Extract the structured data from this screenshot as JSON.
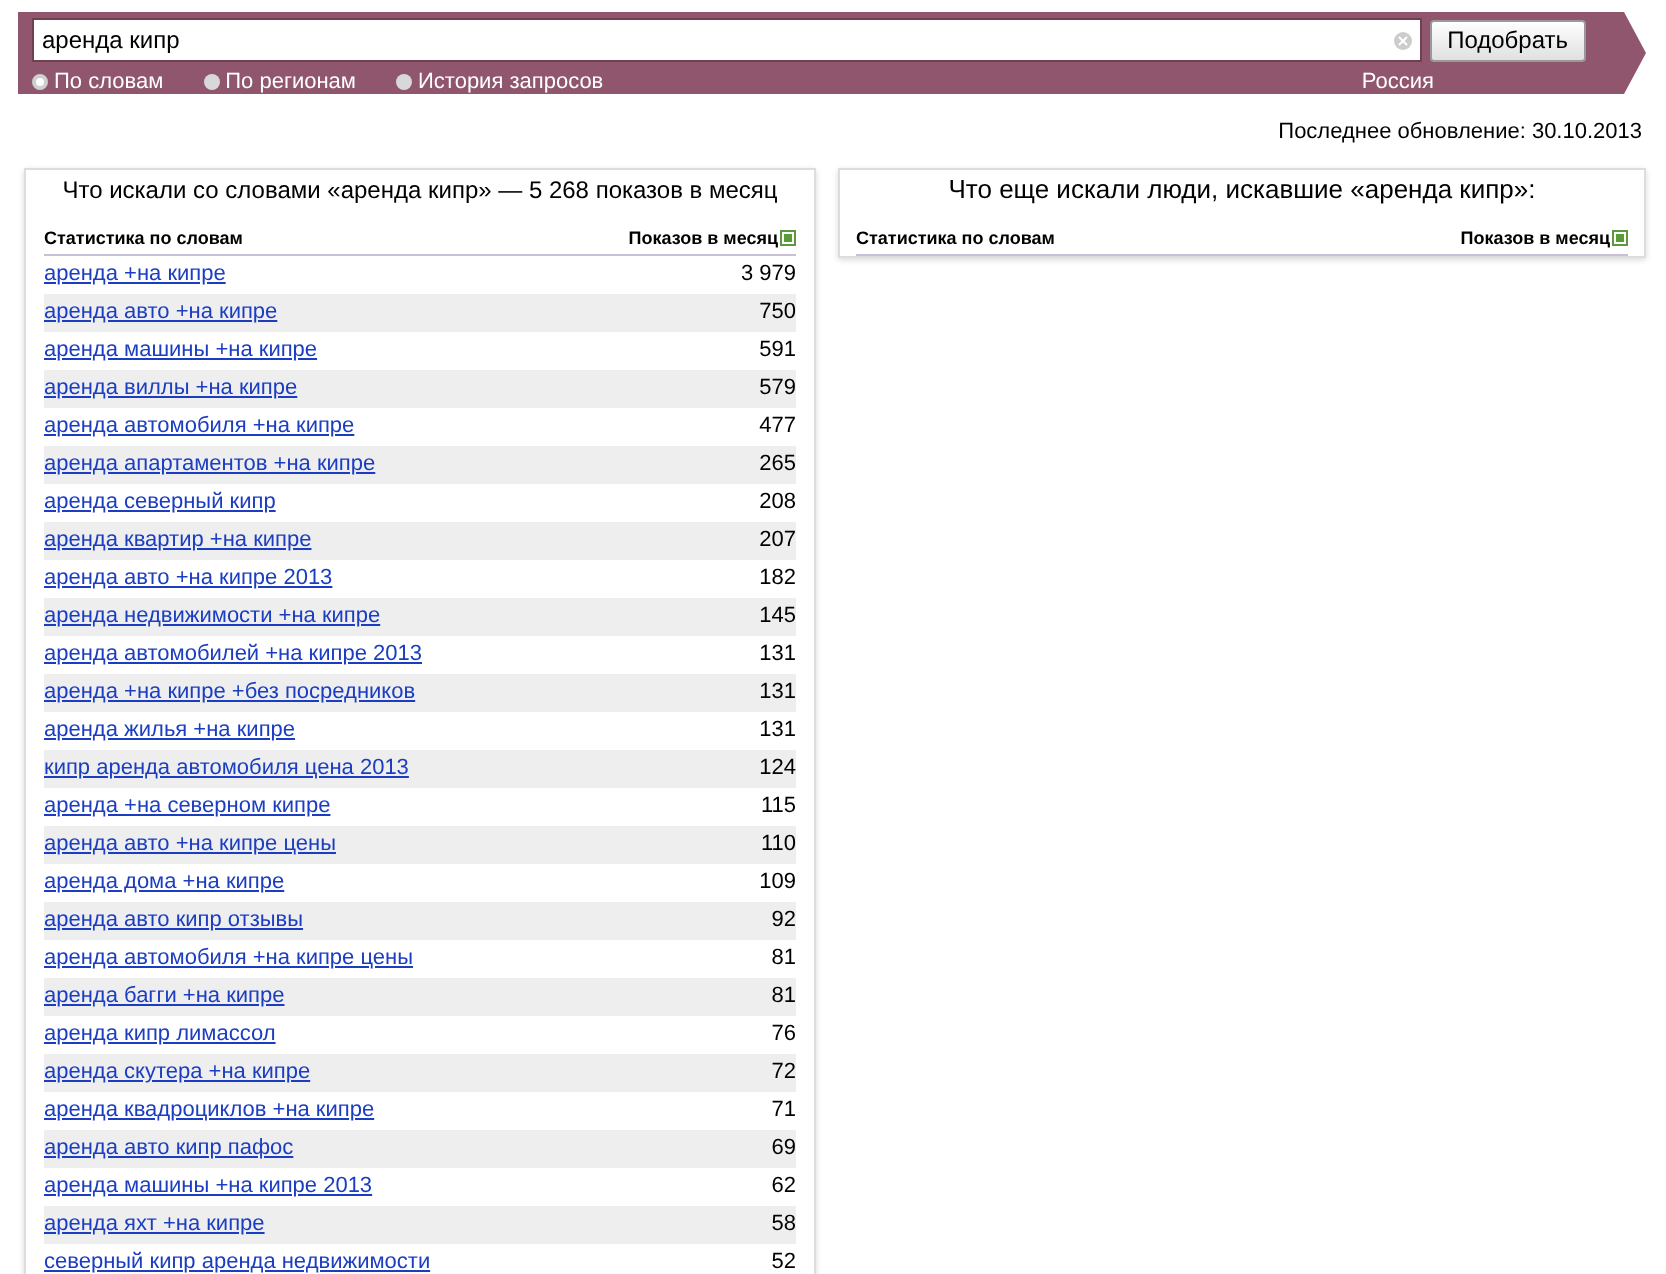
{
  "search": {
    "value": "аренда кипр",
    "button": "Подобрать"
  },
  "modes": [
    {
      "label": "По словам",
      "selected": true
    },
    {
      "label": "По регионам",
      "selected": false
    },
    {
      "label": "История запросов",
      "selected": false
    }
  ],
  "region": "Россия",
  "last_update": "Последнее обновление: 30.10.2013",
  "left_panel": {
    "title": "Что искали со словами «аренда кипр» — 5 268 показов в месяц",
    "columns": [
      "Статистика по словам",
      "Показов в месяц"
    ],
    "rows": [
      {
        "phrase": "аренда +на кипре",
        "count": "3 979"
      },
      {
        "phrase": "аренда авто +на кипре",
        "count": "750"
      },
      {
        "phrase": "аренда машины +на кипре",
        "count": "591"
      },
      {
        "phrase": "аренда виллы +на кипре",
        "count": "579"
      },
      {
        "phrase": "аренда автомобиля +на кипре",
        "count": "477"
      },
      {
        "phrase": "аренда апартаментов +на кипре",
        "count": "265"
      },
      {
        "phrase": "аренда северный кипр",
        "count": "208"
      },
      {
        "phrase": "аренда квартир +на кипре",
        "count": "207"
      },
      {
        "phrase": "аренда авто +на кипре 2013",
        "count": "182"
      },
      {
        "phrase": "аренда недвижимости +на кипре",
        "count": "145"
      },
      {
        "phrase": "аренда автомобилей +на кипре 2013",
        "count": "131"
      },
      {
        "phrase": "аренда +на кипре +без посредников",
        "count": "131"
      },
      {
        "phrase": "аренда жилья +на кипре",
        "count": "131"
      },
      {
        "phrase": "кипр аренда автомобиля цена 2013",
        "count": "124"
      },
      {
        "phrase": "аренда +на северном кипре",
        "count": "115"
      },
      {
        "phrase": "аренда авто +на кипре цены",
        "count": "110"
      },
      {
        "phrase": "аренда дома +на кипре",
        "count": "109"
      },
      {
        "phrase": "аренда авто кипр отзывы",
        "count": "92"
      },
      {
        "phrase": "аренда автомобиля +на кипре цены",
        "count": "81"
      },
      {
        "phrase": "аренда багги +на кипре",
        "count": "81"
      },
      {
        "phrase": "аренда кипр лимассол",
        "count": "76"
      },
      {
        "phrase": "аренда скутера +на кипре",
        "count": "72"
      },
      {
        "phrase": "аренда квадроциклов +на кипре",
        "count": "71"
      },
      {
        "phrase": "аренда авто кипр пафос",
        "count": "69"
      },
      {
        "phrase": "аренда машины +на кипре 2013",
        "count": "62"
      },
      {
        "phrase": "аренда яхт +на кипре",
        "count": "58"
      },
      {
        "phrase": "северный кипр аренда недвижимости",
        "count": "52"
      }
    ]
  },
  "right_panel": {
    "title": "Что еще искали люди, искавшие «аренда кипр»:",
    "columns": [
      "Статистика по словам",
      "Показов в месяц"
    ]
  }
}
